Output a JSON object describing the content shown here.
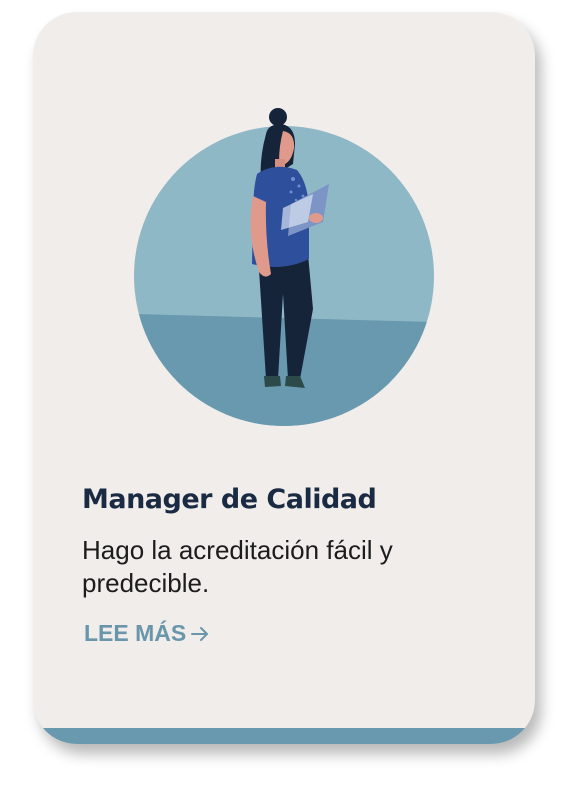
{
  "card": {
    "title": "Manager de Calidad",
    "description": "Hago la acreditación fácil y predecible.",
    "link_label": "LEE MÁS",
    "link_icon": "arrow-right-icon",
    "illustration": "woman-reading-tablet-illustration"
  },
  "colors": {
    "card_background": "#f0edeb",
    "circle_light": "#8fb8c7",
    "circle_floor": "#6899ae",
    "title": "#1a2a42",
    "link": "#6996ab",
    "bottom_bar": "#6899ae"
  }
}
